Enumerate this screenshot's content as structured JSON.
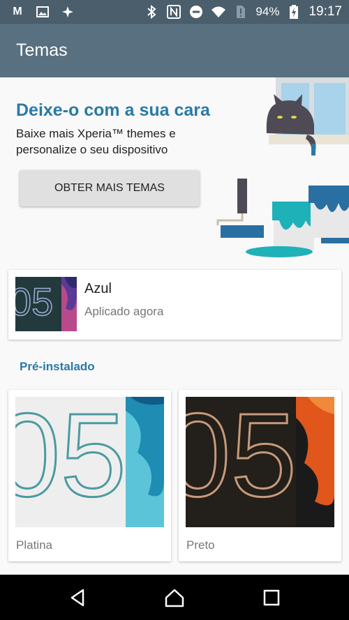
{
  "status_bar": {
    "battery": "94%",
    "time": "19:17",
    "left_icons": [
      "gmail-icon",
      "gallery-icon",
      "app-icon"
    ],
    "right_icons": [
      "bluetooth-icon",
      "nfc-icon",
      "do-not-disturb-icon",
      "wifi-icon",
      "no-sim-icon",
      "battery-charging-icon"
    ]
  },
  "app_bar": {
    "title": "Temas"
  },
  "banner": {
    "title": "Deixe-o com a sua cara",
    "subtitle": "Baixe mais Xperia™ themes e personalize o seu dispositivo",
    "button_label": "OBTER MAIS TEMAS"
  },
  "current_theme": {
    "name": "Azul",
    "status": "Aplicado agora"
  },
  "section_label": "Pré-instalado",
  "themes": [
    {
      "name": "Platina"
    },
    {
      "name": "Preto"
    }
  ],
  "nav_bar": [
    "back-icon",
    "home-icon",
    "recents-icon"
  ],
  "colors": {
    "status_bar": "#4b5e6c",
    "app_bar": "#58707f",
    "accent": "#2a7aa6"
  }
}
